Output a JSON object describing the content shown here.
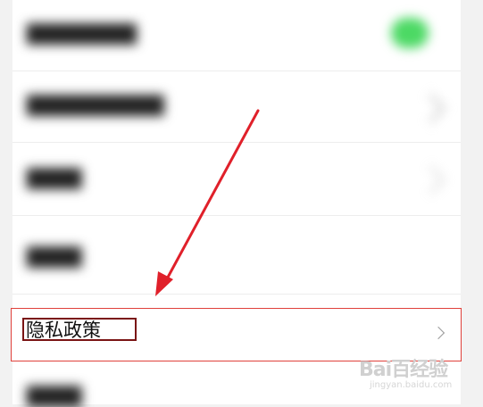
{
  "settings": {
    "privacy_policy_label": "隐私政策"
  },
  "blurred_rows": [
    {
      "label": "████████"
    },
    {
      "label": "██████████"
    },
    {
      "label": "████"
    },
    {
      "label": "████"
    },
    {
      "label": "████"
    }
  ],
  "watermark": {
    "logo": "Bai百经验",
    "sub": "jingyan.baidu.com"
  },
  "colors": {
    "toggle_on": "#4cd964",
    "highlight_border": "#e0413b",
    "label_box_border": "#7a1414",
    "arrow": "#e0202a"
  },
  "icons": {
    "row_chevron": "chevron-right-icon"
  }
}
